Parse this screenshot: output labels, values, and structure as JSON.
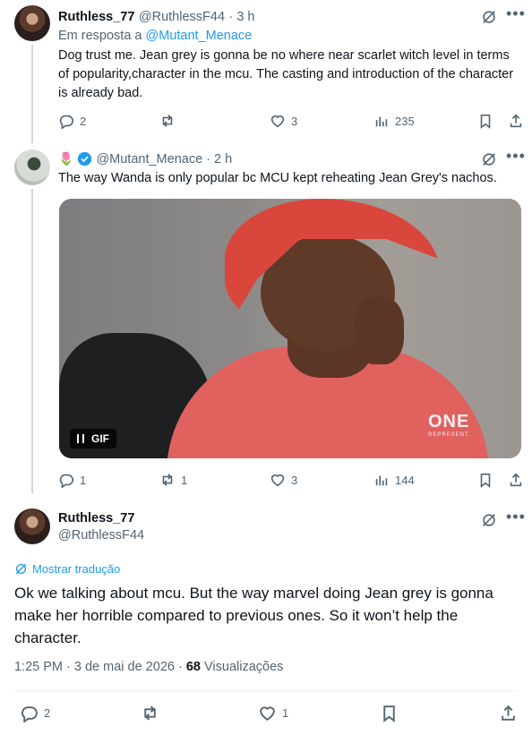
{
  "tweet1": {
    "display_name": "Ruthless_77",
    "handle": "@RuthlessF44",
    "time": "· 3 h",
    "reply_prefix": "Em resposta a",
    "reply_to": "@Mutant_Menace",
    "text": "Dog trust me. Jean grey is gonna be no where near scarlet witch level in terms of popularity,character in the mcu. The casting and introduction of the character is already bad.",
    "replies": "2",
    "retweets": "",
    "likes": "3",
    "views": "235"
  },
  "tweet2": {
    "emoji": "🌷",
    "handle": "@Mutant_Menace",
    "time": "· 2 h",
    "text": "The way Wanda is only popular bc MCU kept reheating Jean Grey's nachos.",
    "gif_label": "GIF",
    "gif_watermark": "ONE",
    "gif_watermark_sub": "REPRESENT.",
    "replies": "1",
    "retweets": "1",
    "likes": "3",
    "views": "144"
  },
  "main_tweet": {
    "display_name": "Ruthless_77",
    "handle": "@RuthlessF44",
    "translate_label": "Mostrar tradução",
    "text": "Ok we talking about mcu.  But the way marvel doing Jean grey is gonna make her horrible compared to previous ones. So it won’t help the character.",
    "timestamp": "1:25 PM · 3 de mai de 2026 ·",
    "views_count": "68",
    "views_label": "Visualizações",
    "replies": "2",
    "likes": "1"
  },
  "colors": {
    "accent": "#1d9bf0",
    "muted": "#536471",
    "verified": "#1d9bf0"
  },
  "icons": [
    "grok-icon",
    "more-icon",
    "reply-icon",
    "retweet-icon",
    "like-icon",
    "views-icon",
    "bookmark-icon",
    "share-icon",
    "verified-icon",
    "translate-icon"
  ]
}
